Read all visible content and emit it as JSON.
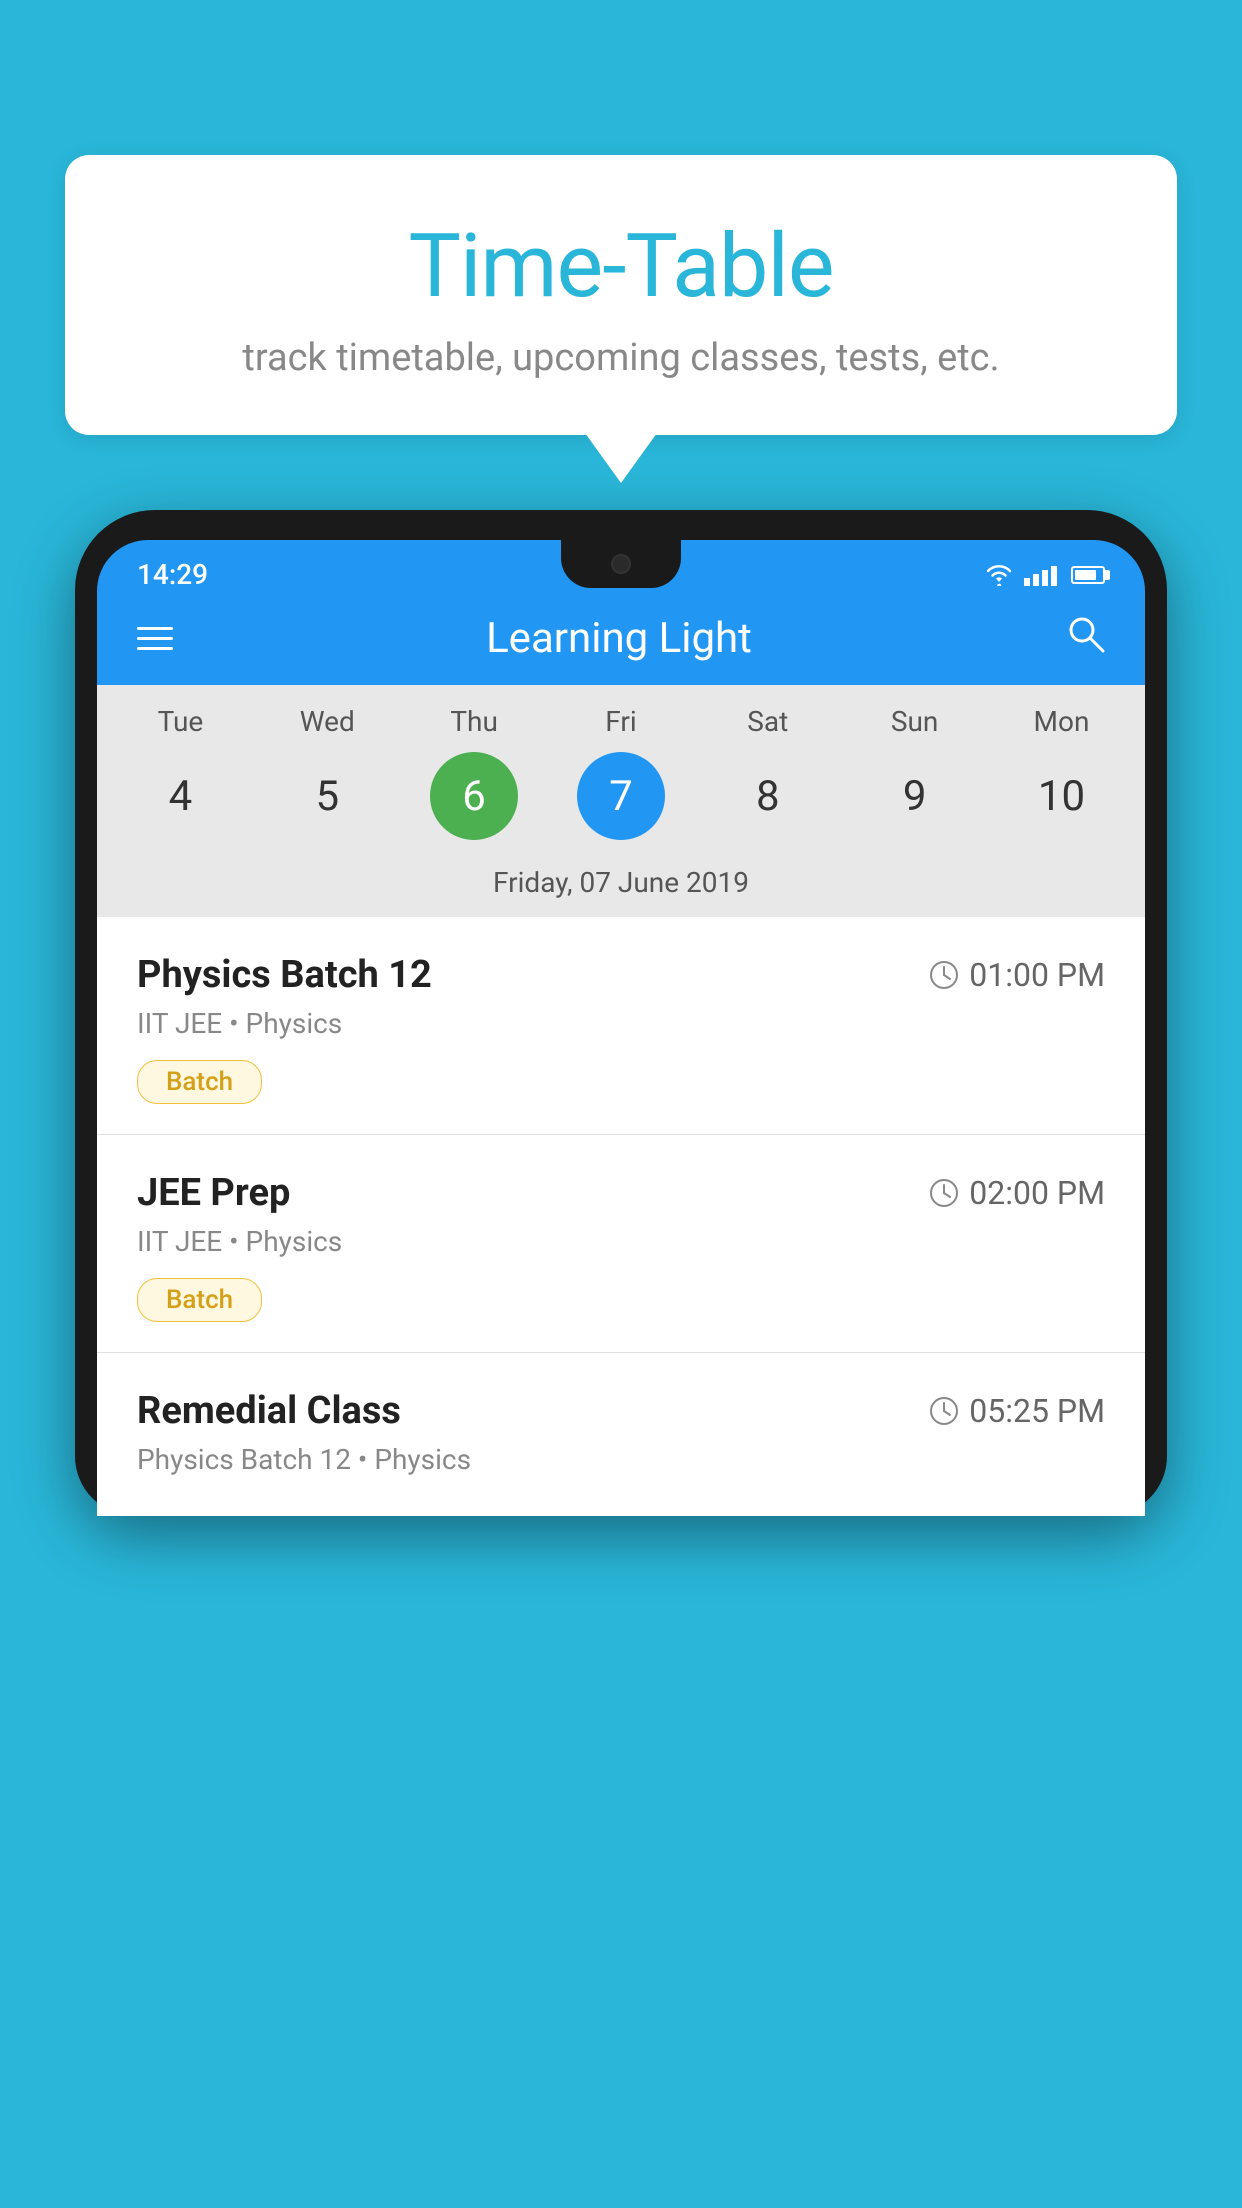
{
  "background": {
    "color": "#29b6d8"
  },
  "speech_bubble": {
    "title": "Time-Table",
    "subtitle": "track timetable, upcoming classes, tests, etc."
  },
  "phone": {
    "status_bar": {
      "time": "14:29"
    },
    "app_header": {
      "title": "Learning Light",
      "search_label": "search"
    },
    "calendar": {
      "days": [
        {
          "label": "Tue",
          "number": "4",
          "state": "normal"
        },
        {
          "label": "Wed",
          "number": "5",
          "state": "normal"
        },
        {
          "label": "Thu",
          "number": "6",
          "state": "today"
        },
        {
          "label": "Fri",
          "number": "7",
          "state": "selected"
        },
        {
          "label": "Sat",
          "number": "8",
          "state": "normal"
        },
        {
          "label": "Sun",
          "number": "9",
          "state": "normal"
        },
        {
          "label": "Mon",
          "number": "10",
          "state": "normal"
        }
      ],
      "selected_date_label": "Friday, 07 June 2019"
    },
    "schedule": [
      {
        "name": "Physics Batch 12",
        "time": "01:00 PM",
        "meta": "IIT JEE • Physics",
        "tag": "Batch"
      },
      {
        "name": "JEE Prep",
        "time": "02:00 PM",
        "meta": "IIT JEE • Physics",
        "tag": "Batch"
      },
      {
        "name": "Remedial Class",
        "time": "05:25 PM",
        "meta": "Physics Batch 12 • Physics",
        "tag": ""
      }
    ]
  }
}
